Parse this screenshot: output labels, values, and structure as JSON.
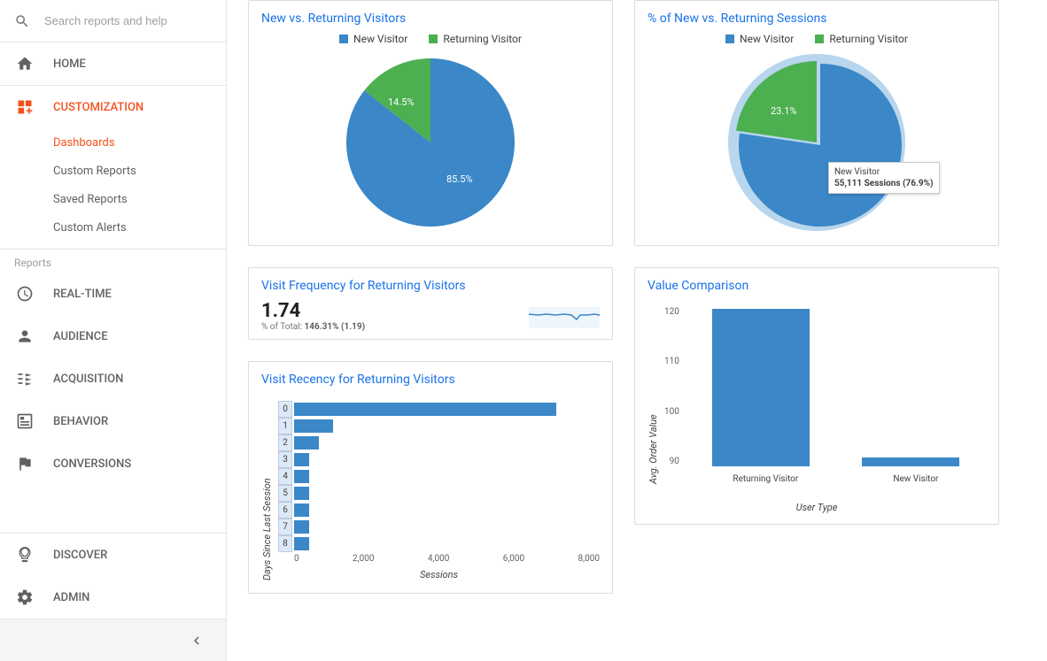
{
  "search": {
    "placeholder": "Search reports and help"
  },
  "nav": {
    "home": "HOME",
    "customization": "CUSTOMIZATION",
    "sub": {
      "dashboards": "Dashboards",
      "custom_reports": "Custom Reports",
      "saved_reports": "Saved Reports",
      "custom_alerts": "Custom Alerts"
    },
    "reports_label": "Reports",
    "realtime": "REAL-TIME",
    "audience": "AUDIENCE",
    "acquisition": "ACQUISITION",
    "behavior": "BEHAVIOR",
    "conversions": "CONVERSIONS",
    "discover": "DISCOVER",
    "admin": "ADMIN"
  },
  "colors": {
    "blue": "#3b87c8",
    "green": "#4caf50",
    "lightblue": "#b8d6ed"
  },
  "cards": {
    "pie1": {
      "title": "New vs. Returning Visitors",
      "legend": [
        "New Visitor",
        "Returning Visitor"
      ],
      "label1": "85.5%",
      "label2": "14.5%"
    },
    "pie2": {
      "title": "% of New vs. Returning Sessions",
      "legend": [
        "New Visitor",
        "Returning Visitor"
      ],
      "label2": "23.1%",
      "tooltip_line1": "New Visitor",
      "tooltip_line2": "55,111 Sessions (76.9%)"
    },
    "freq": {
      "title": "Visit Frequency for Returning Visitors",
      "value": "1.74",
      "sub_prefix": "% of Total: ",
      "sub_bold": "146.31% (1.19)"
    },
    "recency": {
      "title": "Visit Recency for Returning Visitors",
      "ylabel": "Days Since Last Session",
      "xlabel": "Sessions",
      "xticks": [
        "0",
        "2,000",
        "4,000",
        "6,000",
        "8,000"
      ],
      "rows": [
        "0",
        "1",
        "2",
        "3",
        "4",
        "5",
        "6",
        "7",
        "8"
      ]
    },
    "value_comp": {
      "title": "Value Comparison",
      "ylabel": "Avg. Order Value",
      "xlabel": "User Type",
      "yticks": [
        "120",
        "110",
        "100",
        "90"
      ],
      "cats": [
        "Returning Visitor",
        "New Visitor"
      ]
    }
  },
  "chart_data": [
    {
      "type": "pie",
      "title": "New vs. Returning Visitors",
      "series": [
        {
          "name": "New Visitor",
          "value": 85.5
        },
        {
          "name": "Returning Visitor",
          "value": 14.5
        }
      ]
    },
    {
      "type": "pie",
      "title": "% of New vs. Returning Sessions",
      "series": [
        {
          "name": "New Visitor",
          "value": 76.9,
          "sessions": 55111
        },
        {
          "name": "Returning Visitor",
          "value": 23.1
        }
      ]
    },
    {
      "type": "bar",
      "title": "Visit Recency for Returning Visitors",
      "orientation": "horizontal",
      "xlabel": "Sessions",
      "ylabel": "Days Since Last Session",
      "xlim": [
        0,
        8000
      ],
      "categories": [
        "0",
        "1",
        "2",
        "3",
        "4",
        "5",
        "6",
        "7",
        "8"
      ],
      "values": [
        7400,
        1100,
        700,
        420,
        430,
        430,
        420,
        430,
        420
      ]
    },
    {
      "type": "bar",
      "title": "Value Comparison",
      "xlabel": "User Type",
      "ylabel": "Avg. Order Value",
      "ylim": [
        85,
        125
      ],
      "categories": [
        "Returning Visitor",
        "New Visitor"
      ],
      "values": [
        124,
        87
      ]
    },
    {
      "type": "line",
      "title": "Visit Frequency for Returning Visitors (sparkline)",
      "metric": 1.74,
      "pct_of_total": "146.31% (1.19)"
    }
  ]
}
